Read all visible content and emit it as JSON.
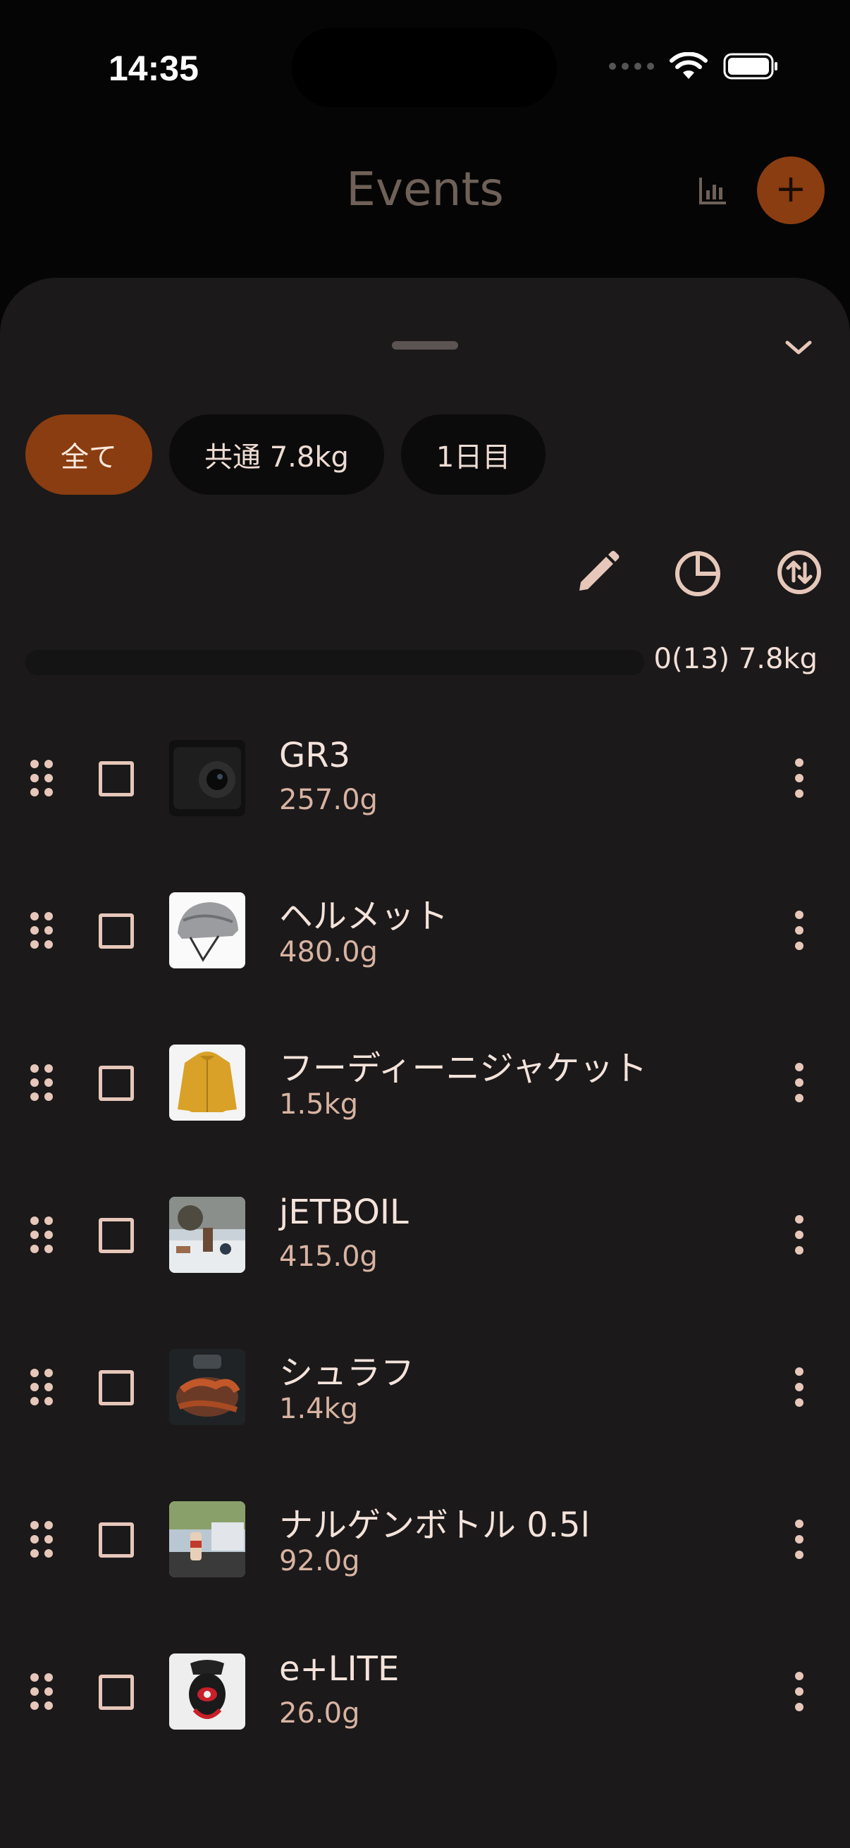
{
  "status_bar": {
    "time": "14:35"
  },
  "header": {
    "title": "Events",
    "add_icon": "+"
  },
  "filters": [
    {
      "label": "全て",
      "active": true
    },
    {
      "label": "共通 7.8kg",
      "active": false
    },
    {
      "label": "1日目",
      "active": false
    }
  ],
  "summary": {
    "text": "0(13) 7.8kg",
    "checked_fraction": 0
  },
  "items": [
    {
      "name": "GR3",
      "weight": "257.0g",
      "checked": false,
      "thumb": "camera"
    },
    {
      "name": "ヘルメット",
      "weight": "480.0g",
      "checked": false,
      "thumb": "helmet"
    },
    {
      "name": "フーディーニジャケット",
      "weight": "1.5kg",
      "checked": false,
      "thumb": "jacket"
    },
    {
      "name": "jETBOIL",
      "weight": "415.0g",
      "checked": false,
      "thumb": "stove-scene"
    },
    {
      "name": "シュラフ",
      "weight": "1.4kg",
      "checked": false,
      "thumb": "sleeping-bag"
    },
    {
      "name": "ナルゲンボトル 0.5l",
      "weight": "92.0g",
      "checked": false,
      "thumb": "bottle-scene"
    },
    {
      "name": "e+LITE",
      "weight": "26.0g",
      "checked": false,
      "thumb": "headlamp"
    }
  ],
  "colors": {
    "accent": "#8a3d10",
    "sheet": "#1b191a",
    "text": "#f4e3da",
    "muted": "#d8b3a1"
  }
}
